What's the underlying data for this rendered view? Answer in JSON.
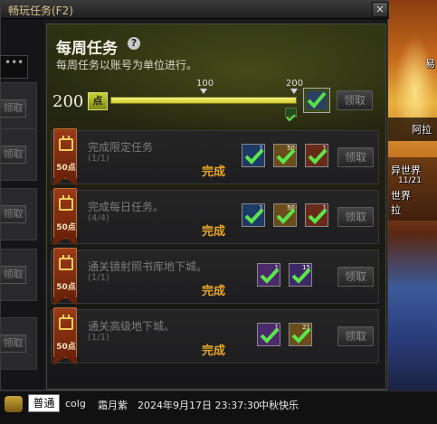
{
  "window": {
    "title": "畅玩任务(F2)",
    "close_label": "×"
  },
  "left_panel": {
    "search_placeholder": "•••",
    "claim_label": "领取"
  },
  "weekly": {
    "title": "每周任务",
    "help": "?",
    "subtitle": "每周任务以账号为单位进行。",
    "points": "200",
    "points_unit": "点",
    "progress_current": 200,
    "progress_max": 200,
    "tick_labels": [
      "100",
      "200"
    ],
    "claim_label": "领取"
  },
  "tasks": [
    {
      "name": "完成限定任务",
      "count": "(1/1)",
      "ribbon": "50点",
      "status": "完成",
      "claim": "领取",
      "rewards": [
        {
          "icon": "blue-box-icon",
          "num": "1"
        },
        {
          "icon": "gold-box-icon",
          "num": "50"
        },
        {
          "icon": "red-box-icon",
          "num": "1"
        }
      ]
    },
    {
      "name": "完成每日任务。",
      "count": "(4/4)",
      "ribbon": "50点",
      "status": "完成",
      "claim": "领取",
      "rewards": [
        {
          "icon": "blue-box-icon",
          "num": "1"
        },
        {
          "icon": "gold-box-icon",
          "num": "50"
        },
        {
          "icon": "red-box-icon",
          "num": "1"
        }
      ]
    },
    {
      "name": "通关镜射照书库地下城。",
      "count": "(1/1)",
      "ribbon": "50点",
      "status": "完成",
      "claim": "领取",
      "rewards": [
        {
          "icon": "purple-box-icon",
          "num": "1"
        },
        {
          "icon": "violet-box-icon",
          "num": "15"
        }
      ]
    },
    {
      "name": "通关高级地下城。",
      "count": "(1/1)",
      "ribbon": "50点",
      "status": "完成",
      "claim": "领取",
      "rewards": [
        {
          "icon": "purple-box-icon",
          "num": "1"
        },
        {
          "icon": "gold-box-icon",
          "num": "21"
        }
      ]
    }
  ],
  "side": {
    "t1": "阿拉",
    "t2": "异世界",
    "t3": "11/21",
    "t4": "世界",
    "t5": "拉",
    "t6": "易"
  },
  "chat": {
    "channel": "普通",
    "user": "colg",
    "name": "霜月紫",
    "datetime": "2024年9月17日 23:37:30",
    "message": "中秋快乐"
  }
}
